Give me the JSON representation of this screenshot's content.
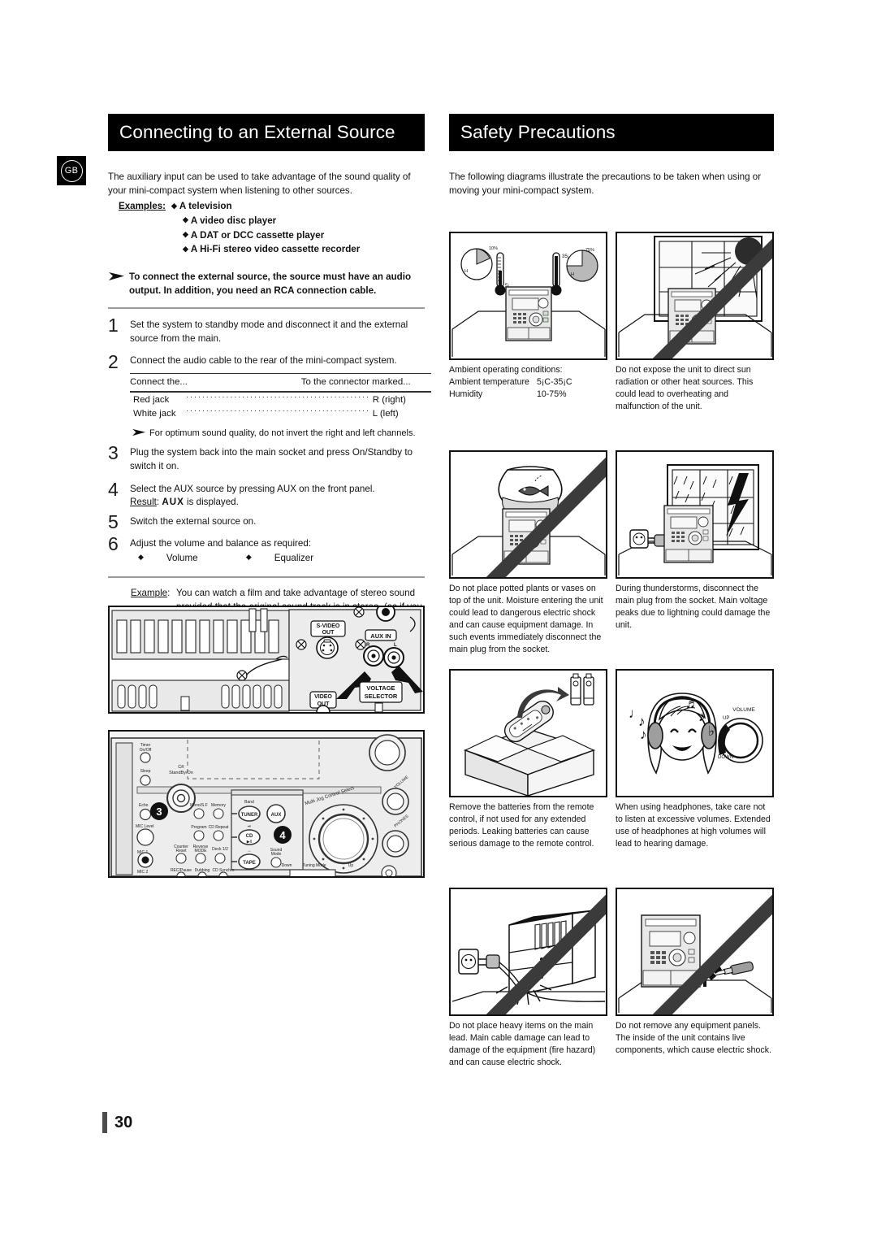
{
  "locale_badge": "GB",
  "page_number": "30",
  "left": {
    "header": "Connecting to an External Source",
    "intro": "The auxiliary input can be used to take advantage of the sound quality of your mini-compact system when listening to other sources.",
    "examples_label": "Examples:",
    "examples": [
      "A television",
      "A video disc player",
      "A DAT or DCC cassette player",
      "A Hi-Fi stereo video cassette recorder"
    ],
    "note": "To connect the external source, the source must have an audio output. In addition, you need an RCA connection cable.",
    "steps": [
      {
        "num": "1",
        "text": "Set the system to standby mode and disconnect it and the external source from the main."
      },
      {
        "num": "2",
        "text": "Connect the audio cable to the rear of the mini-compact system."
      },
      {
        "num": "3",
        "text": "Plug the system back into the main socket and press On/Standby  to switch it on."
      },
      {
        "num": "4",
        "text": "Select the AUX source by pressing AUX on the front panel."
      },
      {
        "num": "5",
        "text": "Switch the external source on."
      },
      {
        "num": "6",
        "text": "Adjust the volume and balance as required:"
      }
    ],
    "connector_table": {
      "head_left": "Connect the...",
      "head_right": "To the connector marked...",
      "rows": [
        {
          "from": "Red jack",
          "to": "R (right)"
        },
        {
          "from": "White jack",
          "to": "L (left)"
        }
      ]
    },
    "step2_note": "For optimum sound quality, do not invert the right and left channels.",
    "step4_result_label": "Result",
    "step4_result_value": "AUX",
    "step4_result_tail": "is displayed.",
    "step6_bullets": [
      "Volume",
      "Equalizer"
    ],
    "example_label": "Example",
    "example_text": "You can watch a film and take advantage of stereo sound provided that the original sound track is in stereo, (as if you were in a cinema).",
    "rear_panel": {
      "labels": {
        "svideo": "S-VIDEO\nOUT",
        "auxin": "AUX IN",
        "aux_r": "R",
        "aux_l": "L",
        "voltage": "VOLTAGE\nSELECTOR",
        "video": "VIDEO\nOUT"
      }
    },
    "front_panel": {
      "callouts": [
        "3",
        "4"
      ],
      "labels": {
        "timer": "Timer\nOn/Off",
        "sleep": "Sleep",
        "standby": "StandBy/On",
        "echo": "Echo",
        "mic_level": "MIC Level",
        "mic1": "MIC 1",
        "mic2": "MIC 2",
        "mono_sf": "Mono/S.F",
        "memory": "Memory",
        "program": "Program",
        "cd_repeat": "CD Repeat",
        "counter": "Counter\nReset",
        "reverse_mode": "Reverse\nMODE",
        "deck": "Deck 1/2",
        "rec_pause": "REC/Pause",
        "dubbing": "Dubbing",
        "cd_synchro": "CD Synchro",
        "band": "Band",
        "tuner": "TUNER",
        "cd": "CD",
        "tape": "TAPE",
        "aux": "AUX",
        "sound": "Sound\nMode",
        "multi_jog": "Multi Jog Control Select",
        "volume": "VOLUME",
        "down": "Down",
        "tuning_mode": "Tuning Mode",
        "up": "Up"
      }
    }
  },
  "right": {
    "header": "Safety Precautions",
    "intro": "The following diagrams illustrate the precautions to be taken when using or moving your mini-compact system.",
    "panels": [
      {
        "figure": "thermometer-humidity-room",
        "caption_type": "table",
        "caption_title": "Ambient operating conditions:",
        "rows": [
          {
            "key": "Ambient temperature",
            "value": "5¡C-35¡C"
          },
          {
            "key": "Humidity",
            "value": "10-75%"
          }
        ]
      },
      {
        "figure": "sun-through-window",
        "caption_type": "text",
        "prohibited": true,
        "caption": "Do not expose the unit to direct sun radiation or other heat sources. This could lead to overheating and malfunction of the unit."
      },
      {
        "figure": "fishbowl-on-unit",
        "caption_type": "text",
        "prohibited": true,
        "caption": "Do not place potted plants or vases on top of the unit. Moisture entering the unit could lead to dangerous electric shock and can cause equipment damage. In such events immediately disconnect the main plug from the socket."
      },
      {
        "figure": "lightning-storm-unplug",
        "caption_type": "text",
        "prohibited": false,
        "caption": "During thunderstorms, disconnect the main plug from the socket. Main voltage peaks due to lightning could damage the unit."
      },
      {
        "figure": "remote-batteries-box",
        "caption_type": "text",
        "prohibited": false,
        "caption": "Remove the batteries from the remote control, if not used for any extended periods. Leaking batteries can cause serious damage to the remote control."
      },
      {
        "figure": "headphones-girl-volume",
        "caption_type": "text",
        "prohibited": false,
        "caption": "When using headphones, take care not to listen at excessive volumes. Extended use of headphones at high volumes will lead to hearing damage."
      },
      {
        "figure": "heavy-furniture-on-cable",
        "caption_type": "text",
        "prohibited": true,
        "caption": "Do not place heavy items on the main lead. Main cable damage can lead to damage of the equipment (fire hazard) and can cause electric shock."
      },
      {
        "figure": "screwdriver-open-panel",
        "caption_type": "text",
        "prohibited": true,
        "caption": "Do not remove any equipment panels. The inside of the unit contains live components, which cause electric shock."
      }
    ],
    "figure_labels": {
      "volume_knob": "VOLUME",
      "volume_up": "UP",
      "volume_down": "DOWN",
      "temp_low": "5¡",
      "temp_high": "35¡",
      "humidity_low": "10%",
      "humidity_high": "75%"
    }
  },
  "colors": {
    "header_bg": "#000000",
    "header_fg": "#ffffff",
    "rule": "#9a9a9a",
    "stripe": "#3b3b3b",
    "panel_fill": "#ececec"
  }
}
